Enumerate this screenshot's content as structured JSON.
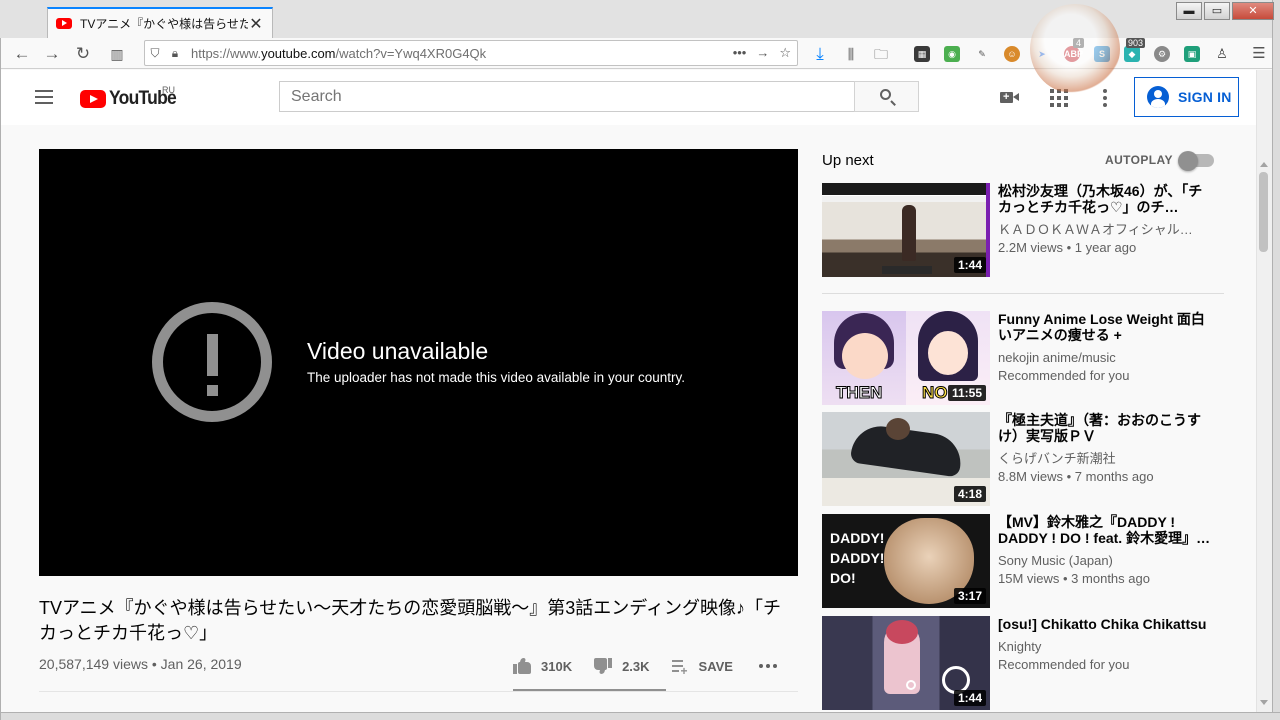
{
  "browser": {
    "tab_title": "TVアニメ『かぐや様は告らせた",
    "tab_close": "✕",
    "url_prefix": "https://www.",
    "url_domain": "youtube.com",
    "url_path": "/watch?v=Ywq4XR0G4Qk",
    "url_more": "•••",
    "ext_badge_abp": "4",
    "ext_badge_count": "903",
    "window_buttons": {
      "minimize": "▬",
      "maximize": "▭",
      "close": "✕"
    }
  },
  "masthead": {
    "logo_text": "YouTube",
    "country": "RU",
    "search_placeholder": "Search",
    "sign_in": "SIGN IN"
  },
  "player": {
    "error_title": "Video unavailable",
    "error_message": "The uploader has not made this video available in your country."
  },
  "video": {
    "title": "TVアニメ『かぐや様は告らせたい～天才たちの恋愛頭脳戦～』第3話エンディング映像♪「チカっとチカ千花っ♡」",
    "views": "20,587,149 views",
    "date": "Jan 26, 2019",
    "likes": "310K",
    "dislikes": "2.3K",
    "save": "SAVE"
  },
  "sidebar": {
    "up_next": "Up next",
    "autoplay": "AUTOPLAY",
    "autoplay_on": false,
    "recommendations": [
      {
        "title": "松村沙友理（乃木坂46）が、「チカっとチカ千花っ♡」のチ…",
        "channel": "ＫＡＤＯＫＡＷＡオフィシャル…",
        "meta": "2.2M views • 1 year ago",
        "duration": "1:44"
      },
      {
        "title": "Funny Anime Lose Weight 面白いアニメの痩せる +",
        "channel": "nekojin anime/music",
        "meta": "Recommended for you",
        "duration": "11:55",
        "thumb_left": "THEN",
        "thumb_right": "NO"
      },
      {
        "title": "『極主夫道』（著：おおのこうすけ）実写版ＰＶ",
        "channel": "くらげバンチ新潮社",
        "meta": "8.8M views • 7 months ago",
        "duration": "4:18"
      },
      {
        "title": "【MV】鈴木雅之『DADDY ! DADDY ! DO ! feat. 鈴木愛理』…",
        "channel": "Sony Music (Japan)",
        "meta": "15M views • 3 months ago",
        "duration": "3:17",
        "thumb_text": "DADDY! DADDY! DO!"
      },
      {
        "title": "[osu!] Chikatto Chika Chikattsu",
        "channel": "Knighty",
        "meta": "Recommended for you",
        "duration": "1:44"
      }
    ]
  },
  "colors": {
    "brand_red": "#ff0000",
    "link_blue": "#065fd4",
    "text_primary": "#030303",
    "text_secondary": "#606060"
  }
}
